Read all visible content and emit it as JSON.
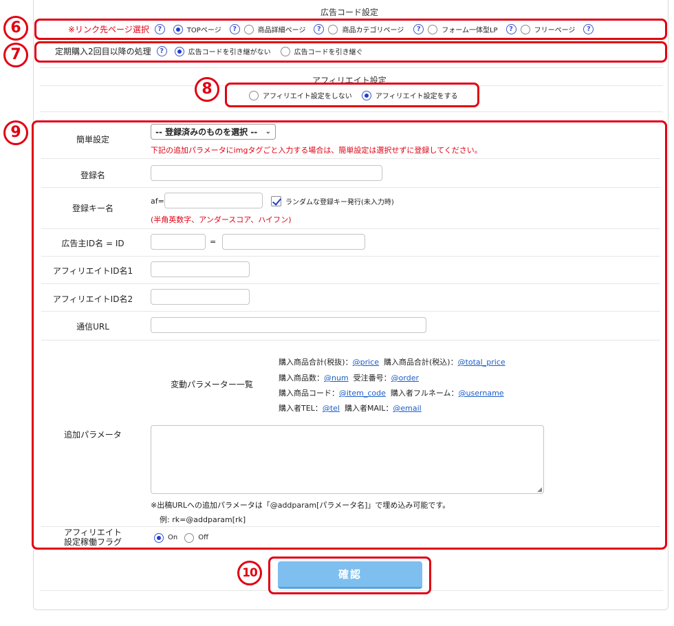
{
  "ad_code": {
    "title": "広告コード設定",
    "link_page": {
      "label": "※リンク先ページ選択",
      "options": [
        {
          "label": "TOPページ",
          "selected": true
        },
        {
          "label": "商品詳細ページ",
          "selected": false
        },
        {
          "label": "商品カテゴリページ",
          "selected": false
        },
        {
          "label": "フォーム一体型LP",
          "selected": false
        },
        {
          "label": "フリーページ",
          "selected": false
        }
      ]
    },
    "second_purchase": {
      "label": "定期購入2回目以降の処理",
      "options": [
        {
          "label": "広告コードを引き継がない",
          "selected": true
        },
        {
          "label": "広告コードを引き継ぐ",
          "selected": false
        }
      ]
    }
  },
  "affiliate": {
    "title": "アフィリエイト設定",
    "options": [
      {
        "label": "アフィリエイト設定をしない",
        "selected": false
      },
      {
        "label": "アフィリエイト設定をする",
        "selected": true
      }
    ]
  },
  "form": {
    "simple_setting": {
      "label": "簡単設定",
      "select_value": "-- 登録済みのものを選択 --",
      "warning": "下記の追加パラメータにimgタグごと入力する場合は、簡単設定は選択せずに登録してください。"
    },
    "reg_name": {
      "label": "登録名",
      "value": ""
    },
    "reg_key": {
      "label": "登録キー名",
      "prefix": "af=",
      "value": "",
      "random_label": "ランダムな登録キー発行(未入力時)",
      "random_checked": true,
      "hint": "(半角英数字、アンダースコア、ハイフン)"
    },
    "advertiser_id": {
      "label": "広告主ID名 = ID",
      "equals": "="
    },
    "affiliate_id1": {
      "label": "アフィリエイトID名1"
    },
    "affiliate_id2": {
      "label": "アフィリエイトID名2"
    },
    "comm_url": {
      "label": "通信URL"
    },
    "variable_params": {
      "label": "変動パラメーター一覧",
      "rows": [
        [
          {
            "text": "購入商品合計(税抜)：",
            "link": "@price"
          },
          {
            "text": "購入商品合計(税込)：",
            "link": "@total_price"
          }
        ],
        [
          {
            "text": "購入商品数：",
            "link": "@num"
          },
          {
            "text": "受注番号：",
            "link": "@order"
          }
        ],
        [
          {
            "text": "購入商品コード：",
            "link": "@item_code"
          },
          {
            "text": "購入者フルネーム：",
            "link": "@username"
          }
        ],
        [
          {
            "text": "購入者TEL：",
            "link": "@tel"
          },
          {
            "text": "購入者MAIL：",
            "link": "@email"
          }
        ]
      ]
    },
    "extra_params": {
      "label": "追加パラメータ",
      "note": "※出稿URLへの追加パラメータは「@addparam[パラメータ名]」で埋め込み可能です。",
      "example": "例: rk=@addparam[rk]"
    },
    "operation_flag": {
      "label_line1": "アフィリエイト",
      "label_line2": "設定稼働フラグ",
      "options": [
        {
          "label": "On",
          "selected": true
        },
        {
          "label": "Off",
          "selected": false
        }
      ]
    }
  },
  "confirm_label": "確認",
  "steps": [
    "6",
    "7",
    "8",
    "9",
    "10"
  ]
}
